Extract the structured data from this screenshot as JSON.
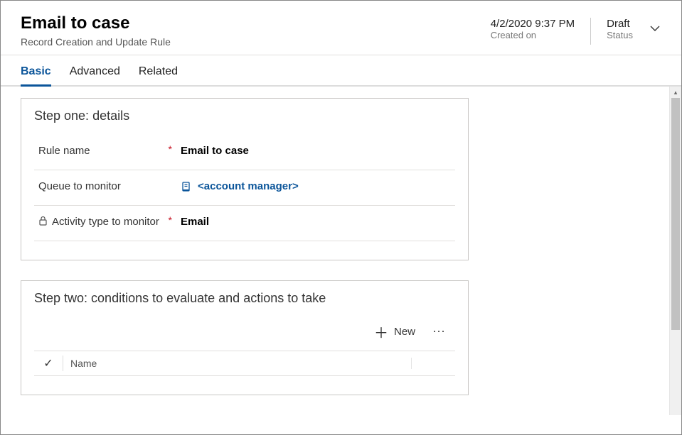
{
  "header": {
    "title": "Email to case",
    "subtitle": "Record Creation and Update Rule",
    "created_on": {
      "value": "4/2/2020 9:37 PM",
      "label": "Created on"
    },
    "status": {
      "value": "Draft",
      "label": "Status"
    }
  },
  "tabs": {
    "basic": "Basic",
    "advanced": "Advanced",
    "related": "Related"
  },
  "step_one": {
    "title": "Step one: details",
    "rule_name": {
      "label": "Rule name",
      "value": "Email to case"
    },
    "queue": {
      "label": "Queue to monitor",
      "value": "<account manager>"
    },
    "activity_type": {
      "label": "Activity type to monitor",
      "value": "Email"
    }
  },
  "step_two": {
    "title": "Step two: conditions to evaluate and actions to take",
    "new_button": "New",
    "grid": {
      "col_name": "Name"
    }
  }
}
